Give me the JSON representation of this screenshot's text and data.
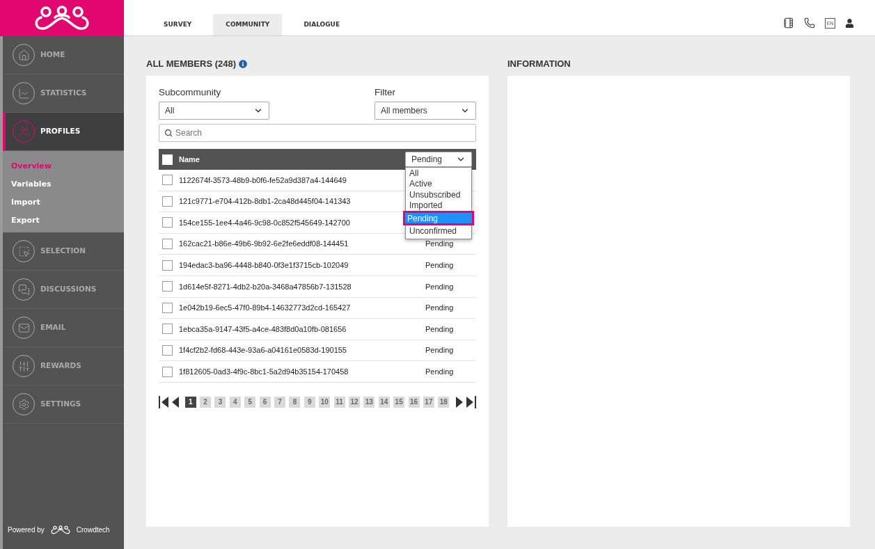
{
  "sidebar": {
    "items": [
      {
        "label": "HOME",
        "selected": false
      },
      {
        "label": "STATISTICS",
        "selected": false
      },
      {
        "label": "PROFILES",
        "selected": true,
        "children": [
          {
            "label": "Overview",
            "selected": true
          },
          {
            "label": "Variables",
            "selected": false
          },
          {
            "label": "Import",
            "selected": false
          },
          {
            "label": "Export",
            "selected": false
          }
        ]
      },
      {
        "label": "SELECTION",
        "selected": false
      },
      {
        "label": "DISCUSSIONS",
        "selected": false
      },
      {
        "label": "EMAIL",
        "selected": false
      },
      {
        "label": "REWARDS",
        "selected": false
      },
      {
        "label": "SETTINGS",
        "selected": false
      }
    ],
    "powered_by": {
      "prefix": "Powered by",
      "brand": "Crowdtech"
    }
  },
  "tabs": [
    {
      "label": "SURVEY",
      "selected": false
    },
    {
      "label": "COMMUNITY",
      "selected": true
    },
    {
      "label": "DIALOGUE",
      "selected": false
    }
  ],
  "toolbar": {
    "language": "EN"
  },
  "members": {
    "title": "ALL MEMBERS (248)",
    "subcommunity": {
      "label": "Subcommunity",
      "value": "All"
    },
    "filter": {
      "label": "Filter",
      "value": "All members"
    },
    "search": {
      "placeholder": "Search"
    },
    "table": {
      "columns": [
        "Name"
      ],
      "header_checked": false,
      "status_filter": {
        "value": "Pending",
        "expanded": true,
        "options": [
          {
            "label": "All",
            "selected": false,
            "highlighted": false
          },
          {
            "label": "Active",
            "selected": false,
            "highlighted": false
          },
          {
            "label": "Unsubscribed",
            "selected": false,
            "highlighted": false
          },
          {
            "label": "Imported",
            "selected": false,
            "highlighted": false
          },
          {
            "label": "Pending",
            "selected": true,
            "highlighted": true
          },
          {
            "label": "Unconfirmed",
            "selected": false,
            "highlighted": false
          }
        ]
      },
      "rows": [
        {
          "name": "1122674f-3573-48b9-b0f6-fe52a9d387a4-144649",
          "checked": false
        },
        {
          "name": "121c9771-e704-412b-8db1-2ca48d445f04-141343",
          "checked": false
        },
        {
          "name": "154ce155-1ee4-4a46-9c98-0c852f545649-142700",
          "checked": false
        },
        {
          "name": "162cac21-b86e-49b6-9b92-6e2fe6eddf08-144451",
          "checked": false,
          "status": "Pending"
        },
        {
          "name": "194edac3-ba96-4448-b840-0f3e1f3715cb-102049",
          "checked": false,
          "status": "Pending"
        },
        {
          "name": "1d614e5f-8271-4db2-b20a-3468a47856b7-131528",
          "checked": false,
          "status": "Pending"
        },
        {
          "name": "1e042b19-6ec5-47f0-89b4-14632773d2cd-165427",
          "checked": false,
          "status": "Pending"
        },
        {
          "name": "1ebca35a-9147-43f5-a4ce-483f8d0a10fb-081656",
          "checked": false,
          "status": "Pending"
        },
        {
          "name": "1f4cf2b2-fd68-443e-93a6-a04161e0583d-190155",
          "checked": false,
          "status": "Pending"
        },
        {
          "name": "1f812605-0ad3-4f9c-8bc1-5a2d94b35154-170458",
          "checked": false,
          "status": "Pending"
        }
      ]
    },
    "pagination": {
      "pages": [
        {
          "label": "1",
          "selected": true
        },
        {
          "label": "2",
          "selected": false
        },
        {
          "label": "3",
          "selected": false
        },
        {
          "label": "4",
          "selected": false
        },
        {
          "label": "5",
          "selected": false
        },
        {
          "label": "6",
          "selected": false
        },
        {
          "label": "7",
          "selected": false
        },
        {
          "label": "8",
          "selected": false
        },
        {
          "label": "9",
          "selected": false
        },
        {
          "label": "10",
          "selected": false
        },
        {
          "label": "11",
          "selected": false
        },
        {
          "label": "12",
          "selected": false
        },
        {
          "label": "13",
          "selected": false
        },
        {
          "label": "14",
          "selected": false
        },
        {
          "label": "15",
          "selected": false
        },
        {
          "label": "16",
          "selected": false
        },
        {
          "label": "17",
          "selected": false
        },
        {
          "label": "18",
          "selected": false
        }
      ]
    }
  },
  "information": {
    "title": "INFORMATION"
  }
}
